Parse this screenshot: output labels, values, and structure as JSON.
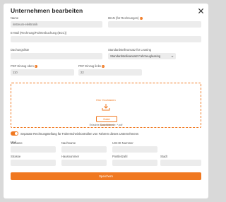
{
  "dialog": {
    "title": "Unternehmen bearbeiten"
  },
  "fields": {
    "name": {
      "label": "Name",
      "value": "instreum-elektronik"
    },
    "iban": {
      "label": "IBAN (für Rechnungen)",
      "value": ""
    },
    "email": {
      "label": "E-Mail (Rechnung/Fahrtenbuchung (BCC))",
      "value": ""
    },
    "prefix": {
      "label": "Dachungsliste",
      "value": ""
    },
    "location": {
      "label": "Standardstelleunsatz für Leasing",
      "value": "Standardstelleansatz Fahrzeugleasing"
    },
    "pdf_left": {
      "label": "PDF Einzug oben",
      "value": "110"
    },
    "pdf_right": {
      "label": "PDF Einzug links",
      "value": "22"
    },
    "mail": {
      "label": "Mail",
      "value": ""
    },
    "first_name": {
      "label": "Vorname",
      "value": ""
    },
    "last_name": {
      "label": "Nachname",
      "value": ""
    },
    "vat_id": {
      "label": "USt-ID Nummer",
      "value": ""
    },
    "street": {
      "label": "Strasse",
      "value": ""
    },
    "house_number": {
      "label": "Hausnummer",
      "value": ""
    },
    "postal_code": {
      "label": "Postleitzahl",
      "value": ""
    },
    "city": {
      "label": "Stadt",
      "value": ""
    }
  },
  "upload": {
    "label": "Hier Hochladen",
    "button": "Datei auswählen",
    "formats": "Erlaubte Dateiformate: *.pdf",
    "icon": "upload-icon"
  },
  "toggle": {
    "label": "Separate Rechnungstellung für Fahrerscheinkontrollen von Fahrern dieses Unternehmens",
    "checked": true
  },
  "save_label": "Speichern",
  "colors": {
    "accent": "#f07820",
    "field_bg": "#ececec"
  }
}
